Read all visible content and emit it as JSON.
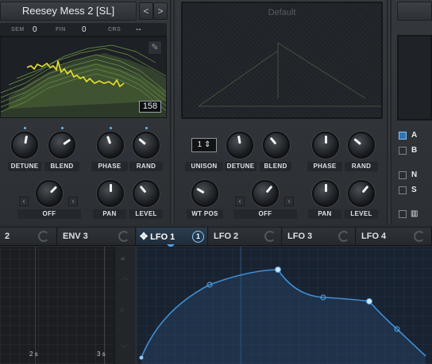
{
  "osc_a": {
    "preset_name": "Reesey Mess 2 [SL]",
    "nav_prev": "<",
    "nav_next": ">",
    "params": [
      {
        "label": "SEM",
        "value": "0"
      },
      {
        "label": "FIN",
        "value": "0"
      },
      {
        "label": "CRS",
        "value": "--"
      }
    ],
    "wt_frame": "158",
    "knobs_row1": [
      "DETUNE",
      "BLEND",
      "PHASE",
      "RAND"
    ],
    "knobs_row2": [
      "PAN",
      "LEVEL"
    ],
    "warp_value": "OFF"
  },
  "osc_b": {
    "preset_name": "Default",
    "unison_value": "1",
    "knobs_row1": [
      "UNISON",
      "DETUNE",
      "BLEND",
      "PHASE",
      "RAND"
    ],
    "knobs_row2": [
      "WT POS",
      "PAN",
      "LEVEL"
    ],
    "warp_value": "OFF"
  },
  "right_panel": {
    "toggles": [
      {
        "label": "A",
        "checked": true
      },
      {
        "label": "B",
        "checked": false
      },
      {
        "label": "N",
        "checked": false
      },
      {
        "label": "S",
        "checked": false
      }
    ]
  },
  "mod_tabs": [
    {
      "label": "2",
      "active": false
    },
    {
      "label": "ENV 3",
      "active": false
    },
    {
      "label": "LFO 1",
      "active": true,
      "badge": "1"
    },
    {
      "label": "LFO 2",
      "active": false
    },
    {
      "label": "LFO 3",
      "active": false
    },
    {
      "label": "LFO 4",
      "active": false
    }
  ],
  "env_graph": {
    "time_labels": [
      "2 s",
      "3 s"
    ]
  },
  "colors": {
    "accent_blue": "#3f8fd6",
    "wavetable_yellow": "#e8e22a",
    "wavetable_green": "#7fb04a"
  }
}
